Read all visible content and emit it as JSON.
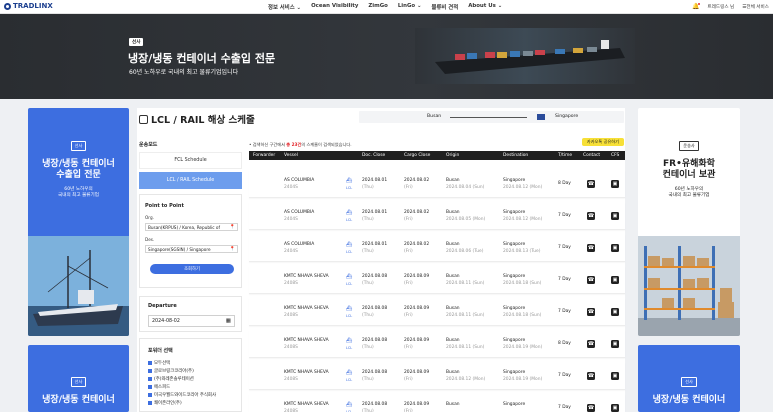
{
  "brand": {
    "logo": "TRADLINX",
    "accent": "#3d6ee0",
    "dark": "#1f1f1f"
  },
  "nav": {
    "items": [
      "정보 서비스 ⌄",
      "Ocean Visibility",
      "ZimGo",
      "LinGo ⌄",
      "물류비 견적",
      "About Us ⌄"
    ],
    "user": "트레드링스 님",
    "all_services": "☰전체 서비스"
  },
  "hero": {
    "tag": "선사",
    "title": "냉장/냉동 컨테이너 수출입 전문",
    "subtitle": "60년 노하우로 국내의 최고 물류기업입니다"
  },
  "ad_left_top": {
    "badge": "선사",
    "title_l1": "냉장/냉동 컨테이너",
    "title_l2": "수출입 전문",
    "text_l1": "60년 노하우의",
    "text_l2": "국내의 최고 물류기업"
  },
  "ad_left_bottom": {
    "badge": "선사",
    "title_l1": "냉장/냉동 컨테이너"
  },
  "ad_right_top": {
    "badge": "운송사",
    "title_l1": "FR•유해화학",
    "title_l2": "컨테이너 보관",
    "text_l1": "60년 노하우의",
    "text_l2": "국내의 최고 물류기업"
  },
  "ad_right_bottom": {
    "badge": "선사",
    "title_l1": "냉장/냉동 컨테이너"
  },
  "schedule": {
    "title": "LCL / RAIL 해상 스케줄",
    "route_from": "Busan",
    "route_to": "Singapore",
    "mode_label": "운송모드",
    "mode_fcl": "FCL Schedule",
    "mode_lcl": "LCL / RAIL Schedule",
    "p2p_label": "Point to Point",
    "org_label": "Org.",
    "org_value": "Busan(KRPUS) / Korea, Republic of",
    "des_label": "Des.",
    "des_value": "Singapore(SGSIN) / Singapore",
    "search_btn": "조회하기",
    "departure_label": "Departure",
    "departure_value": "2024-08-02",
    "forwarder_label": "포워더 선택",
    "forwarders": [
      "모두선택",
      "글로브링크코리아(주)",
      "(주)와레존솔루테이션",
      "에스피드",
      "미국우월드와이드코리아 주식회사",
      "쾌이존라인(주)"
    ],
    "result_prefix": "• 검색하신 구간에서",
    "result_count": "총 23건",
    "result_suffix": "의 스케줄이 검색되었습니다.",
    "notice_btn": "카카오톡 공유하기",
    "columns": [
      "Forwarder",
      "Vessel",
      "Doc. Close",
      "Cargo Close",
      "Origin",
      "Destination",
      "T/time",
      "Contact",
      "CFS"
    ]
  },
  "rows": [
    {
      "vessel": "AS COLUMBIA",
      "voy": "2404S",
      "doc": "2024.08.01",
      "doc_d": "(Thu)",
      "cargo": "2024.08.02",
      "cargo_d": "(Fri)",
      "origin": "Busan",
      "origin_d": "2024.08.04 (Sun)",
      "dest": "Singapore",
      "dest_d": "2024.08.12 (Mon)",
      "tt": "8 Day"
    },
    {
      "vessel": "AS COLUMBIA",
      "voy": "2404S",
      "doc": "2024.08.01",
      "doc_d": "(Thu)",
      "cargo": "2024.08.02",
      "cargo_d": "(Fri)",
      "origin": "Busan",
      "origin_d": "2024.08.05 (Mon)",
      "dest": "Singapore",
      "dest_d": "2024.08.12 (Mon)",
      "tt": "7 Day"
    },
    {
      "vessel": "AS COLUMBIA",
      "voy": "2404S",
      "doc": "2024.08.01",
      "doc_d": "(Thu)",
      "cargo": "2024.08.02",
      "cargo_d": "(Fri)",
      "origin": "Busan",
      "origin_d": "2024.08.06 (Tue)",
      "dest": "Singapore",
      "dest_d": "2024.08.13 (Tue)",
      "tt": "7 Day"
    },
    {
      "vessel": "KMTC NHAVA SHEVA",
      "voy": "2408S",
      "doc": "2024.08.08",
      "doc_d": "(Thu)",
      "cargo": "2024.08.09",
      "cargo_d": "(Fri)",
      "origin": "Busan",
      "origin_d": "2024.08.11 (Sun)",
      "dest": "Singapore",
      "dest_d": "2024.08.18 (Sun)",
      "tt": "7 Day"
    },
    {
      "vessel": "KMTC NHAVA SHEVA",
      "voy": "2408S",
      "doc": "2024.08.08",
      "doc_d": "(Thu)",
      "cargo": "2024.08.09",
      "cargo_d": "(Fri)",
      "origin": "Busan",
      "origin_d": "2024.08.11 (Sun)",
      "dest": "Singapore",
      "dest_d": "2024.08.18 (Sun)",
      "tt": "7 Day"
    },
    {
      "vessel": "KMTC NHAVA SHEVA",
      "voy": "2408S",
      "doc": "2024.08.08",
      "doc_d": "(Thu)",
      "cargo": "2024.08.09",
      "cargo_d": "(Fri)",
      "origin": "Busan",
      "origin_d": "2024.08.11 (Sun)",
      "dest": "Singapore",
      "dest_d": "2024.08.19 (Mon)",
      "tt": "8 Day"
    },
    {
      "vessel": "KMTC NHAVA SHEVA",
      "voy": "2408S",
      "doc": "2024.08.08",
      "doc_d": "(Thu)",
      "cargo": "2024.08.09",
      "cargo_d": "(Fri)",
      "origin": "Busan",
      "origin_d": "2024.08.12 (Mon)",
      "dest": "Singapore",
      "dest_d": "2024.08.19 (Mon)",
      "tt": "7 Day"
    },
    {
      "vessel": "KMTC NHAVA SHEVA",
      "voy": "2408S",
      "doc": "2024.08.08",
      "doc_d": "(Thu)",
      "cargo": "2024.08.09",
      "cargo_d": "(Fri)",
      "origin": "Busan",
      "origin_d": "",
      "dest": "Singapore",
      "dest_d": "",
      "tt": "7 Day"
    }
  ],
  "lcl_tag": "LCL",
  "icons": {
    "phone": "phone-icon",
    "cfs": "camera-icon"
  }
}
